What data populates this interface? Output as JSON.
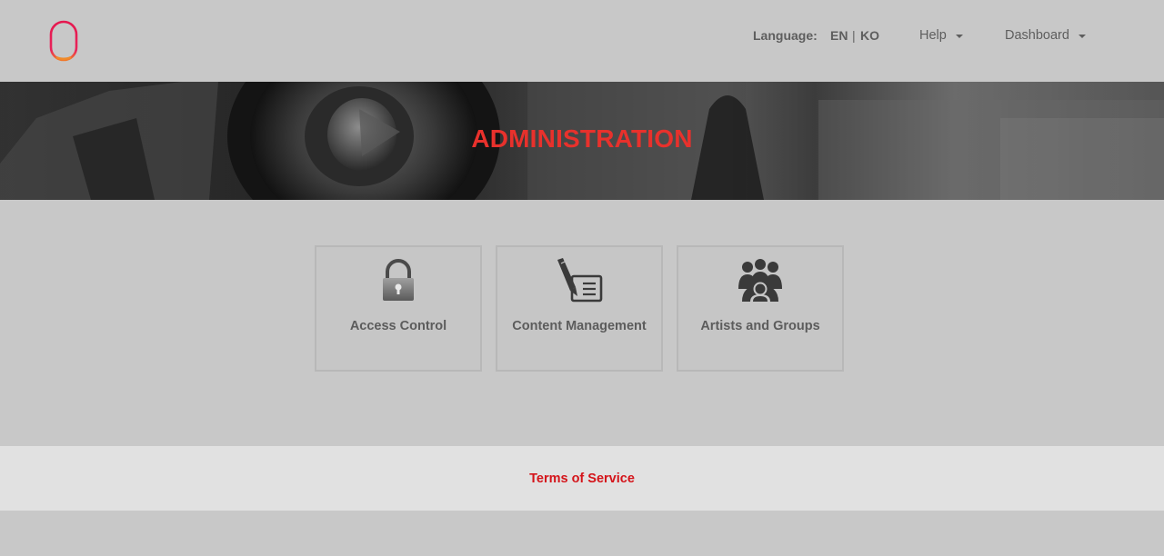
{
  "header": {
    "logo_icon": "brand-logo-icon",
    "language_label": "Language:",
    "languages": [
      "EN",
      "KO"
    ],
    "language_separator": "|",
    "menu": {
      "help_label": "Help",
      "dashboard_label": "Dashboard"
    }
  },
  "hero": {
    "title": "ADMINISTRATION"
  },
  "tiles": [
    {
      "label": "Access Control",
      "icon": "padlock-icon"
    },
    {
      "label": "Content Management",
      "icon": "pen-document-icon"
    },
    {
      "label": "Artists and Groups",
      "icon": "group-people-icon"
    }
  ],
  "footer": {
    "terms_label": "Terms of Service"
  },
  "colors": {
    "accent": "#e8312c",
    "link": "#d4141a",
    "background": "#c8c8c8",
    "footer_bg": "#e1e1e1"
  }
}
